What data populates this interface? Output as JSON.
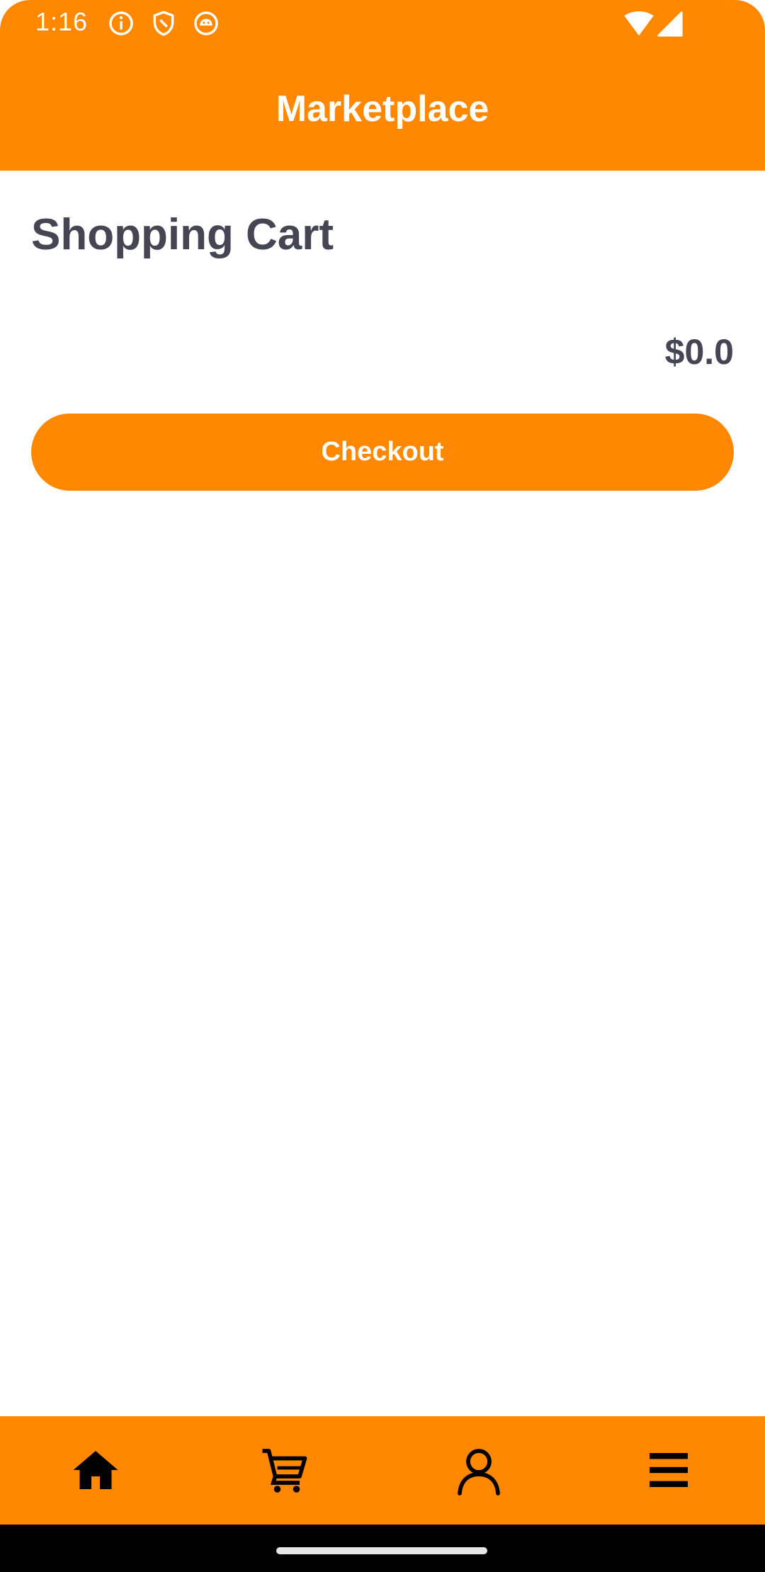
{
  "status_bar": {
    "time": "1:16",
    "icons": [
      "info-icon",
      "shield-icon",
      "android-icon",
      "wifi-icon",
      "signal-icon"
    ]
  },
  "app_bar": {
    "title": "Marketplace"
  },
  "cart": {
    "title": "Shopping Cart",
    "total": "$0.0",
    "checkout_label": "Checkout"
  },
  "bottom_nav": {
    "items": [
      "home-icon",
      "cart-icon",
      "profile-icon",
      "menu-icon"
    ]
  },
  "colors": {
    "accent": "#FF8800",
    "text_dark": "#454554",
    "on_accent": "#FFFFFF"
  }
}
